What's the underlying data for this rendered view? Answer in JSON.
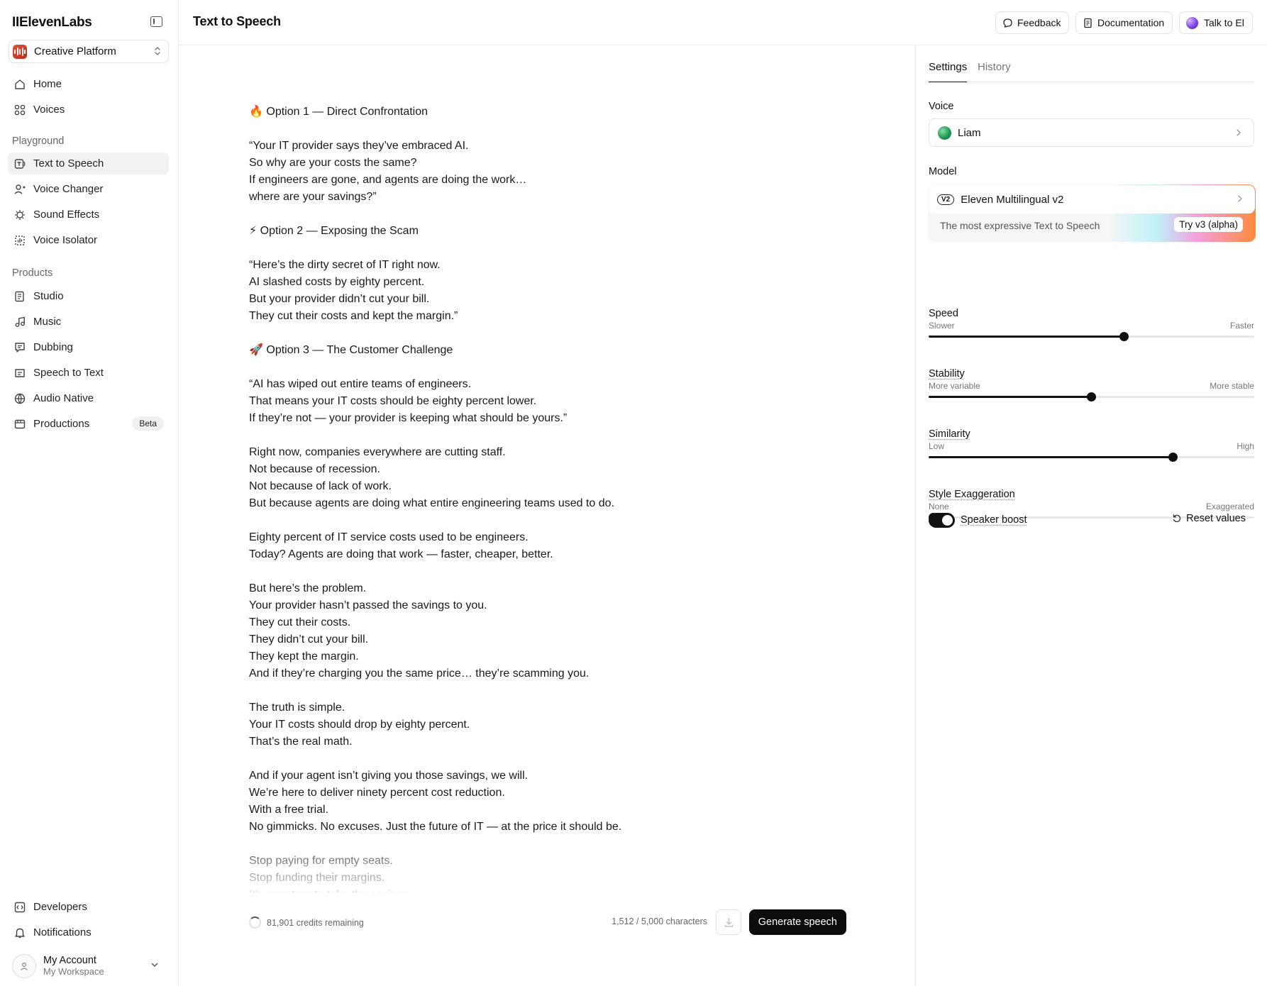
{
  "sidebar": {
    "logo": "IIElevenLabs",
    "workspace": "Creative Platform",
    "nav_top": [
      {
        "label": "Home"
      },
      {
        "label": "Voices"
      }
    ],
    "playground_label": "Playground",
    "playground": [
      {
        "label": "Text to Speech",
        "active": true
      },
      {
        "label": "Voice Changer"
      },
      {
        "label": "Sound Effects"
      },
      {
        "label": "Voice Isolator"
      }
    ],
    "products_label": "Products",
    "products": [
      {
        "label": "Studio"
      },
      {
        "label": "Music"
      },
      {
        "label": "Dubbing"
      },
      {
        "label": "Speech to Text"
      },
      {
        "label": "Audio Native"
      },
      {
        "label": "Productions",
        "badge": "Beta"
      }
    ],
    "bottom": [
      {
        "label": "Developers"
      },
      {
        "label": "Notifications"
      }
    ],
    "account": {
      "name": "My Account",
      "workspace": "My Workspace"
    }
  },
  "header": {
    "title": "Text to Speech",
    "feedback": "Feedback",
    "documentation": "Documentation",
    "talk": "Talk to El"
  },
  "editor": {
    "text": "🔥 Option 1 — Direct Confrontation\n\n“Your IT provider says they’ve embraced AI.\nSo why are your costs the same?\nIf engineers are gone, and agents are doing the work…\nwhere are your savings?”\n\n⚡ Option 2 — Exposing the Scam\n\n“Here’s the dirty secret of IT right now.\nAI slashed costs by eighty percent.\nBut your provider didn’t cut your bill.\nThey cut their costs and kept the margin.”\n\n🚀 Option 3 — The Customer Challenge\n\n“AI has wiped out entire teams of engineers.\nThat means your IT costs should be eighty percent lower.\nIf they’re not — your provider is keeping what should be yours.”\n\nRight now, companies everywhere are cutting staff.\nNot because of recession.\nNot because of lack of work.\nBut because agents are doing what entire engineering teams used to do.\n\nEighty percent of IT service costs used to be engineers.\nToday? Agents are doing that work — faster, cheaper, better.\n\nBut here’s the problem.\nYour provider hasn’t passed the savings to you.\nThey cut their costs.\nThey didn’t cut your bill.\nThey kept the margin.\nAnd if they’re charging you the same price… they’re scamming you.\n\nThe truth is simple.\nYour IT costs should drop by eighty percent.\nThat’s the real math.\n\nAnd if your agent isn’t giving you those savings, we will.\nWe’re here to deliver ninety percent cost reduction.\nWith a free trial.\nNo gimmicks. No excuses. Just the future of IT — at the price it should be.\n\nStop paying for empty seats.\nStop funding their margins.\nIt’s your turn to take the savings.",
    "credits": "81,901 credits remaining",
    "char_count": "1,512 / 5,000 characters",
    "generate": "Generate speech"
  },
  "panel": {
    "tabs": [
      "Settings",
      "History"
    ],
    "voice_label": "Voice",
    "voice": "Liam",
    "model_label": "Model",
    "model_badge": "V2",
    "model": "Eleven Multilingual v2",
    "model_desc": "The most expressive Text to Speech",
    "try_v3": "Try v3 (alpha)",
    "sliders": [
      {
        "label": "Speed",
        "left": "Slower",
        "right": "Faster",
        "value": 0.6
      },
      {
        "label": "Stability",
        "left": "More variable",
        "right": "More stable",
        "value": 0.5
      },
      {
        "label": "Similarity",
        "left": "Low",
        "right": "High",
        "value": 0.75
      },
      {
        "label": "Style Exaggeration",
        "left": "None",
        "right": "Exaggerated",
        "value": 0.0
      }
    ],
    "speaker_boost": "Speaker boost",
    "speaker_boost_on": true,
    "reset": "Reset values"
  }
}
